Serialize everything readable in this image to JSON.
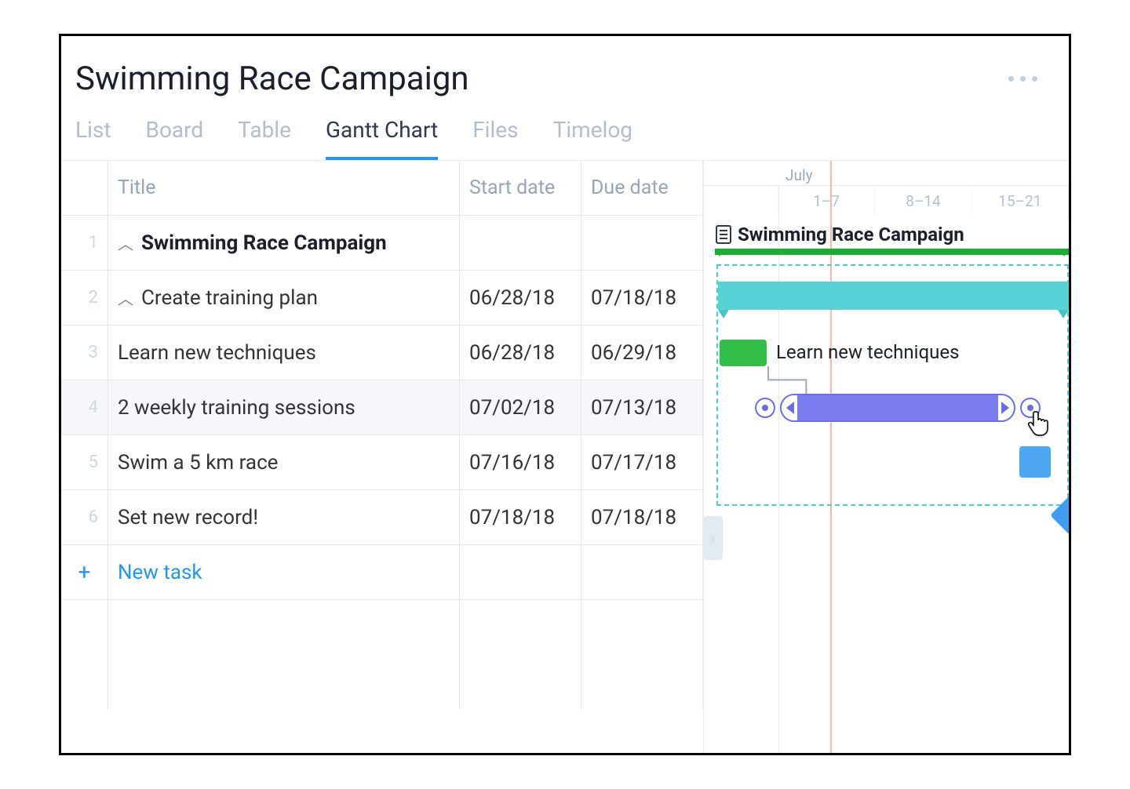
{
  "header": {
    "title": "Swimming Race Campaign"
  },
  "tabs": [
    {
      "label": "List",
      "active": false
    },
    {
      "label": "Board",
      "active": false
    },
    {
      "label": "Table",
      "active": false
    },
    {
      "label": "Gantt Chart",
      "active": true
    },
    {
      "label": "Files",
      "active": false
    },
    {
      "label": "Timelog",
      "active": false
    }
  ],
  "columns": {
    "title": "Title",
    "start": "Start date",
    "due": "Due date"
  },
  "rows": [
    {
      "num": "1",
      "title": "Swimming Race Campaign",
      "start": "",
      "due": "",
      "type": "project"
    },
    {
      "num": "2",
      "title": "Create training plan",
      "start": "06/28/18",
      "due": "07/18/18",
      "type": "group"
    },
    {
      "num": "3",
      "title": "Learn new techniques",
      "start": "06/28/18",
      "due": "06/29/18",
      "type": "task"
    },
    {
      "num": "4",
      "title": "2 weekly training sessions",
      "start": "07/02/18",
      "due": "07/13/18",
      "type": "task",
      "selected": true
    },
    {
      "num": "5",
      "title": "Swim a 5 km race",
      "start": "07/16/18",
      "due": "07/17/18",
      "type": "task"
    },
    {
      "num": "6",
      "title": "Set new record!",
      "start": "07/18/18",
      "due": "07/18/18",
      "type": "milestone"
    }
  ],
  "new_task": "New task",
  "timeline": {
    "month": "July",
    "weeks": [
      "",
      "1–7",
      "8–14",
      "15–21"
    ],
    "campaign_label": "Swimming Race Campaign",
    "learn_label": "Learn new techniques"
  },
  "chart_data": {
    "type": "gantt",
    "title": "Swimming Race Campaign",
    "x_axis": {
      "unit": "date",
      "range": [
        "2018-06-28",
        "2018-07-21"
      ],
      "month_label": "July",
      "week_labels": [
        "1–7",
        "8–14",
        "15–21"
      ],
      "today": "2018-07-03"
    },
    "tasks": [
      {
        "id": 1,
        "name": "Swimming Race Campaign",
        "type": "summary",
        "start": "2018-06-28",
        "end": "2018-07-21",
        "color": "#1baf2f"
      },
      {
        "id": 2,
        "name": "Create training plan",
        "type": "summary",
        "start": "2018-06-28",
        "end": "2018-07-18",
        "color": "#57d3d5",
        "parent": 1
      },
      {
        "id": 3,
        "name": "Learn new techniques",
        "type": "task",
        "start": "2018-06-28",
        "end": "2018-06-29",
        "color": "#33c048",
        "parent": 2
      },
      {
        "id": 4,
        "name": "2 weekly training sessions",
        "type": "task",
        "start": "2018-07-02",
        "end": "2018-07-13",
        "color": "#7a7df0",
        "parent": 2,
        "selected": true,
        "depends_on": [
          3
        ]
      },
      {
        "id": 5,
        "name": "Swim a 5 km race",
        "type": "task",
        "start": "2018-07-16",
        "end": "2018-07-17",
        "color": "#4ea7f2",
        "parent": 2
      },
      {
        "id": 6,
        "name": "Set new record!",
        "type": "milestone",
        "start": "2018-07-18",
        "end": "2018-07-18",
        "color": "#3f9df2",
        "parent": 2
      }
    ]
  }
}
